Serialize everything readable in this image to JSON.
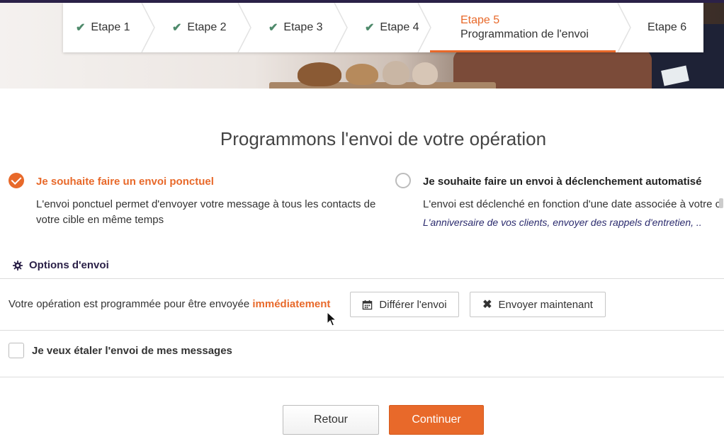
{
  "steps": [
    {
      "label": "Etape 1",
      "done": true
    },
    {
      "label": "Etape 2",
      "done": true
    },
    {
      "label": "Etape 3",
      "done": true
    },
    {
      "label": "Etape 4",
      "done": true
    },
    {
      "label": "Etape 5",
      "sublabel": "Programmation de l'envoi",
      "active": true
    },
    {
      "label": "Etape 6"
    }
  ],
  "page_title": "Programmons l'envoi de votre opération",
  "choice_single": {
    "title": "Je souhaite faire un envoi ponctuel",
    "description": "L'envoi ponctuel permet d'envoyer votre message à tous les contacts de votre cible en même temps",
    "selected": true
  },
  "choice_auto": {
    "title": "Je souhaite faire un envoi à déclenchement automatisé",
    "description": "L'envoi est déclenché en fonction d'une date associée à votre c",
    "example": "L'anniversaire de vos clients, envoyer des rappels d'entretien, ..",
    "selected": false
  },
  "options": {
    "heading": "Options d'envoi",
    "programmed_text": "Votre opération est programmée pour être envoyée",
    "programmed_highlight": "immédiatement",
    "defer_label": "Différer l'envoi",
    "send_now_label": "Envoyer maintenant",
    "spread_label": "Je veux étaler l'envoi de mes messages"
  },
  "footer": {
    "back_label": "Retour",
    "continue_label": "Continuer"
  },
  "colors": {
    "accent": "#e8692a",
    "navy": "#2b2148",
    "check_green": "#4e8a6b"
  }
}
